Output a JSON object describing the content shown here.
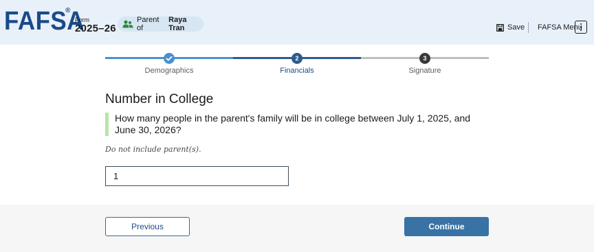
{
  "header": {
    "logo": "FAFSA",
    "logo_mark": "®",
    "form_label": "Form",
    "form_year": "2025–26",
    "role_prefix": "Parent of",
    "role_name": "Raya Tran",
    "role_icon": "users-icon",
    "save_label": "Save",
    "save_icon": "floppy-disk-icon",
    "menu_label": "FAFSA Menu",
    "menu_icon": "vertical-ellipsis-icon"
  },
  "stepper": {
    "steps": [
      {
        "number": "1",
        "label": "Demographics",
        "state": "complete"
      },
      {
        "number": "2",
        "label": "Financials",
        "state": "current"
      },
      {
        "number": "3",
        "label": "Signature",
        "state": "upcoming"
      }
    ]
  },
  "main": {
    "title": "Number in College",
    "question": "How many people in the parent's family will be in college between July 1, 2025, and June 30, 2026?",
    "hint": "Do not include parent(s).",
    "answer_value": "1"
  },
  "footer": {
    "previous_label": "Previous",
    "continue_label": "Continue"
  },
  "colors": {
    "header_bg": "#e8f1fa",
    "brand": "#1a4a8a",
    "step_complete": "#4a90d0",
    "step_current": "#2c5c8c",
    "step_upcoming": "#bdbdbd",
    "callout_border": "#b7e5a7",
    "primary_button": "#3973a5"
  }
}
